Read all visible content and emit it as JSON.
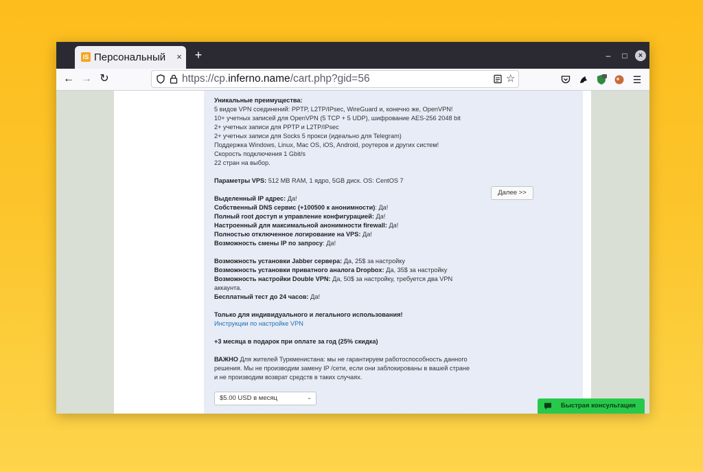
{
  "browser": {
    "tab_title": "Персональный VP",
    "tab_favicon": "IS",
    "tab_close": "×",
    "new_tab": "+",
    "url_prefix": "https://cp.",
    "url_domain": "inferno.name",
    "url_path": "/cart.php?gid=56",
    "window_controls": {
      "minimize": "–",
      "maximize": "□",
      "close": "×"
    }
  },
  "icons": [
    "back-arrow-icon",
    "forward-arrow-icon",
    "reload-icon",
    "shield-icon",
    "lock-icon",
    "reader-view-icon",
    "bookmark-star-icon",
    "pocket-icon",
    "extension-icon",
    "menu-icon",
    "chat-icon"
  ],
  "product": {
    "lines": [
      {
        "bold": "Уникальные преимущества:",
        "text": ""
      },
      {
        "bold": "",
        "text": "5 видов VPN соединений: PPTP, L2TP/IPsec, WireGuard и, конечно же, OpenVPN!"
      },
      {
        "bold": "",
        "text": "10+ учетных записей для OpenVPN (5 TCP + 5 UDP), шифрование AES-256 2048 bit"
      },
      {
        "bold": "",
        "text": "2+ учетных записи для PPTP и L2TP/IPsec"
      },
      {
        "bold": "",
        "text": "2+ учетных записи для Socks 5 прокси (идеально для Telegram)"
      },
      {
        "bold": "",
        "text": "Поддержка Windows, Linux, Mac OS, iOS, Android, роутеров и других систем!"
      },
      {
        "bold": "",
        "text": "Скорость подключения 1 Gbit/s"
      },
      {
        "bold": "",
        "text": "22 стран на выбор."
      },
      {
        "gap": true
      },
      {
        "bold": "Параметры VPS:",
        "text": " 512 MB RAM, 1 ядро, 5GB диск. OS: CentOS 7"
      },
      {
        "gap": true
      },
      {
        "bold": "Выделенный IP адрес:",
        "text": " Да!"
      },
      {
        "bold": "Собственный DNS сервис (+100500 к анонимности)",
        "text": ": Да!"
      },
      {
        "bold": "Полный root доступ и управление конфигурацией:",
        "text": " Да!"
      },
      {
        "bold": "Настроенный для максимальной анонимности firewall:",
        "text": " Да!"
      },
      {
        "bold": "Полностью отключенное логирование на VPS:",
        "text": " Да!"
      },
      {
        "bold": "Возможность смены IP по запросу",
        "text": ": Да!"
      },
      {
        "gap": true
      },
      {
        "bold": "Возможность установки Jabber сервера:",
        "text": " Да, 25$ за настройку"
      },
      {
        "bold": "Возможность установки приватного аналога Dropbox:",
        "text": " Да, 35$ за настройку"
      },
      {
        "bold": "Возможность настройки Double VPN:",
        "text": " Да, 50$ за настройку, требуется два VPN"
      },
      {
        "bold": "",
        "text": "аккаунта."
      },
      {
        "bold": "Бесплатный тест до 24 часов:",
        "text": " Да!"
      },
      {
        "gap": true
      },
      {
        "bold": "Только для индивидуального и легального использования!",
        "text": ""
      },
      {
        "link": "Инструкции по настройке VPN"
      },
      {
        "gap": true
      },
      {
        "bold": "+3 месяца в подарок при оплате за год (25% скидка)",
        "text": ""
      },
      {
        "gap": true
      },
      {
        "bold": "ВАЖНО",
        "text": " Для жителей Туркменистана: мы не гарантируем работоспособность данного"
      },
      {
        "bold": "",
        "text": "решения. Мы не производим замену IP /сети, если они заблокированы в вашей стране"
      },
      {
        "bold": "",
        "text": "и не производим возврат средств в таких случаях."
      }
    ],
    "next_button": "Далее >>",
    "billing_select": "$5.00 USD в месяц"
  },
  "chat_widget": {
    "label": "Быстрая консультация"
  },
  "colors": {
    "background": "#fdbd1c",
    "page_panel": "#e7ecf7",
    "chat": "#27c94b",
    "link": "#1f6fb2"
  }
}
